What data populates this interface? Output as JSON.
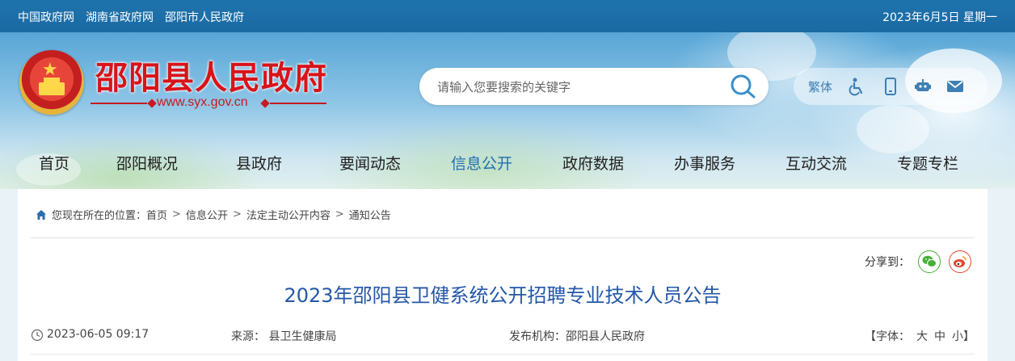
{
  "topbar": {
    "links": [
      "中国政府网",
      "湖南省政府网",
      "邵阳市人民政府"
    ],
    "date": "2023年6月5日 星期一"
  },
  "header": {
    "site_title": "邵阳县人民政府",
    "site_url": "www.syx.gov.cn"
  },
  "search": {
    "placeholder": "请输入您要搜索的关键字"
  },
  "tools": {
    "traditional_label": "繁体",
    "icons": [
      "accessibility-icon",
      "mobile-icon",
      "robot-icon",
      "mail-icon"
    ]
  },
  "nav": {
    "items": [
      "首页",
      "邵阳概况",
      "县政府",
      "要闻动态",
      "信息公开",
      "政府数据",
      "办事服务",
      "互动交流",
      "专题专栏"
    ],
    "active": "信息公开"
  },
  "breadcrumb": {
    "prefix": "您现在所在的位置：",
    "items": [
      "首页",
      "信息公开",
      "法定主动公开内容",
      "通知公告"
    ]
  },
  "share": {
    "label": "分享到："
  },
  "article": {
    "title": "2023年邵阳县卫健系统公开招聘专业技术人员公告",
    "datetime": "2023-06-05 09:17",
    "source": "来源：  县卫生健康局",
    "publisher": "发布机构：邵阳县人民政府",
    "font_label": "【字体：",
    "font_options": [
      "大",
      "中",
      "小"
    ],
    "font_close": "】"
  },
  "colors": {
    "topbar": "#1f73ad",
    "title_red": "#d8141a",
    "nav_active": "#1f6fb2",
    "article_title": "#2457a8"
  }
}
